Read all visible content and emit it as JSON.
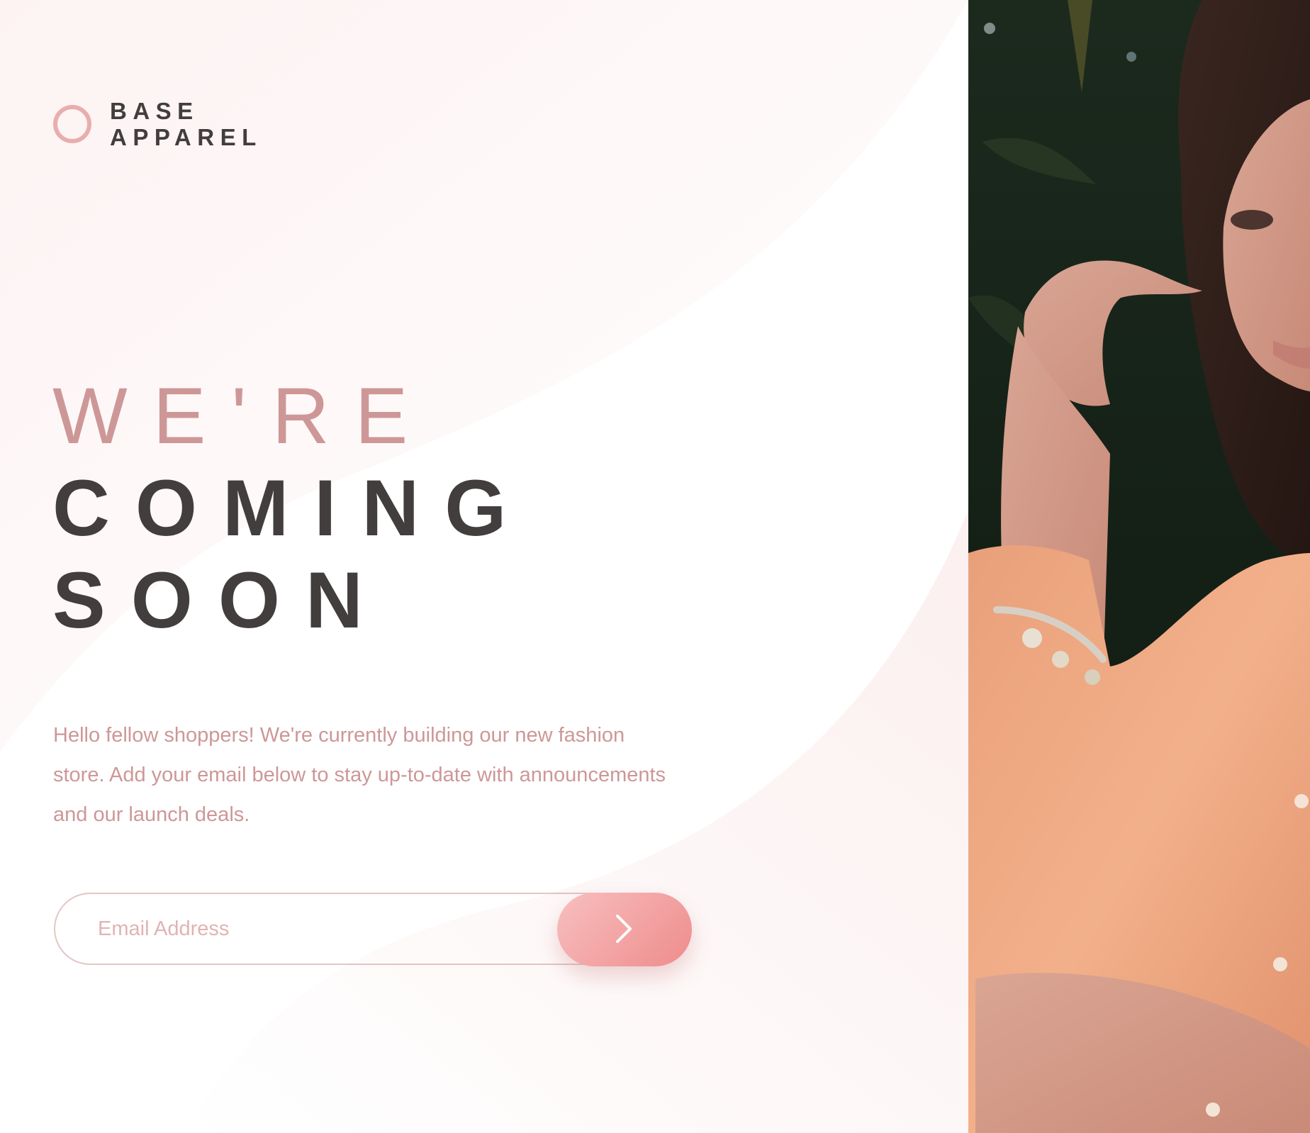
{
  "brand": {
    "line1": "BASE",
    "line2": "APPAREL",
    "ring_color": "#e8aeae"
  },
  "hero": {
    "line1": "WE'RE",
    "line2": "COMING",
    "line3": "SOON"
  },
  "description": "Hello fellow shoppers! We're currently building our new fashion store. Add your email below to stay up-to-date with announcements and our launch deals.",
  "form": {
    "email_placeholder": "Email Address",
    "email_value": "",
    "submit_icon": "chevron-right-icon"
  },
  "hero_image": {
    "subject": "woman-in-orange-shirt-photo"
  },
  "colors": {
    "desaturated_red": "#ce9797",
    "dark_grayish_red": "#433e3e",
    "gradient_start": "#f8bfbf",
    "gradient_end": "#ee8c8c"
  }
}
